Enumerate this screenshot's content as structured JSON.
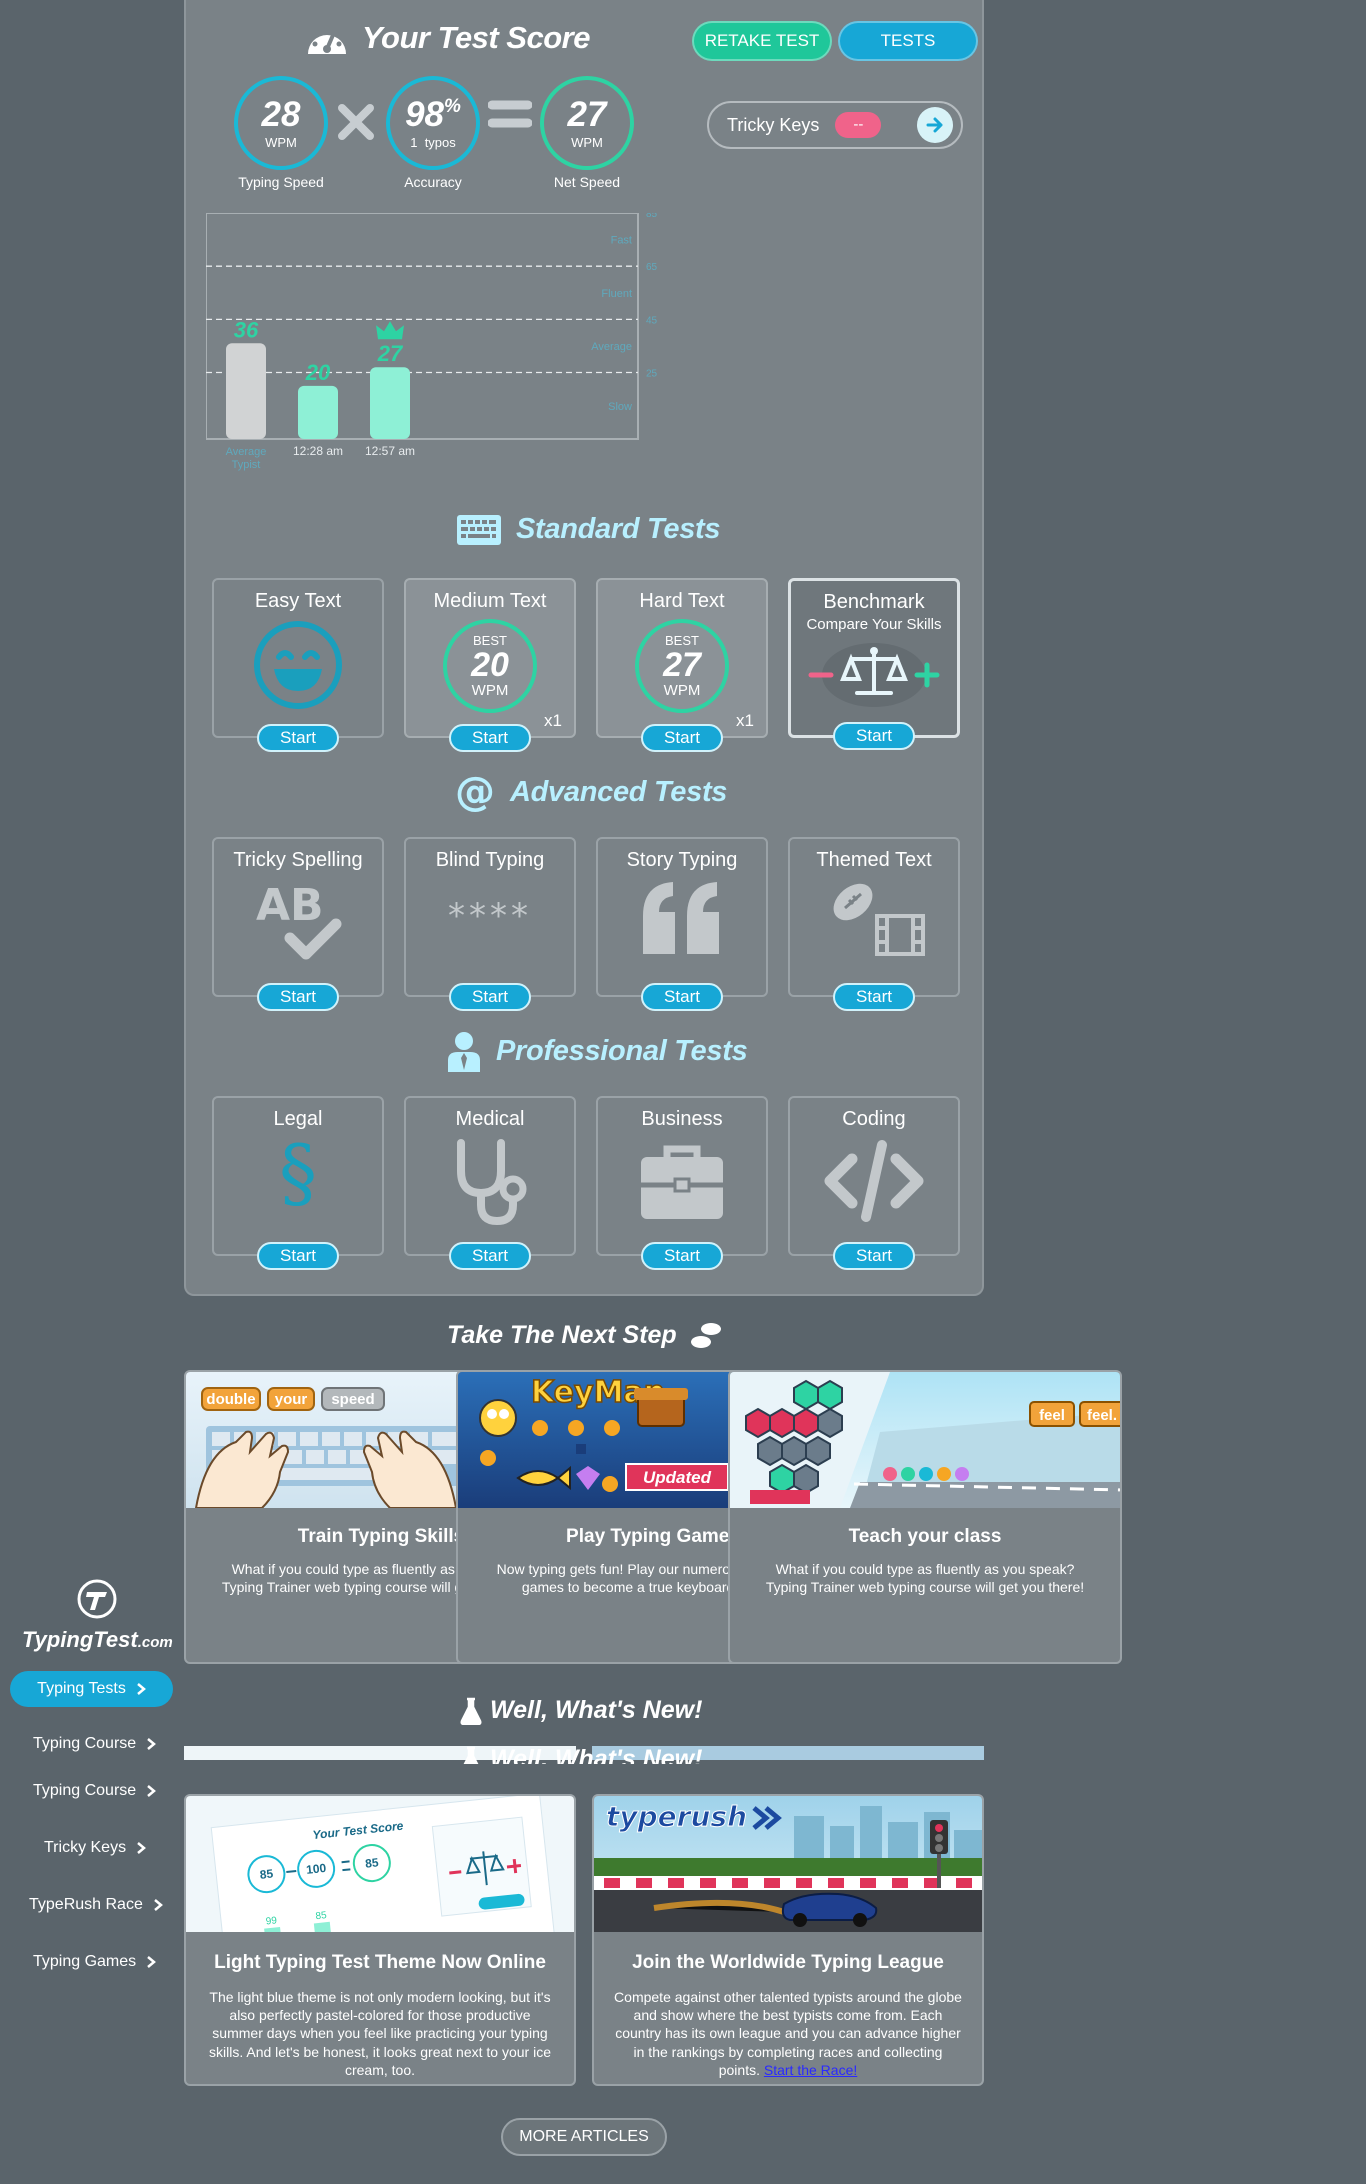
{
  "header": {
    "title": "Your Test Score",
    "retake_label": "RETAKE TEST",
    "tests_label": "TESTS"
  },
  "score": {
    "speed_value": "28",
    "speed_unit": "WPM",
    "speed_label": "Typing Speed",
    "accuracy_value": "98",
    "accuracy_suffix": "%",
    "accuracy_typos": "1  typos",
    "accuracy_label": "Accuracy",
    "net_value": "27",
    "net_unit": "WPM",
    "net_label": "Net Speed"
  },
  "tricky_keys": {
    "label": "Tricky Keys",
    "badge": "--"
  },
  "chart_data": {
    "type": "bar",
    "categories": [
      "Average Typist",
      "12:28 am",
      "12:57 am"
    ],
    "values": [
      36,
      20,
      27
    ],
    "value_labels": [
      "36",
      "20",
      "27"
    ],
    "ylim": [
      0,
      85
    ],
    "y_ticks": [
      25,
      45,
      65,
      85
    ],
    "zones": [
      "Slow",
      "Average",
      "Fluent",
      "Fast"
    ],
    "best_index": 2,
    "colors": {
      "average": "#d1d3d4",
      "user": "#8ef0d6",
      "label": "#2ed3a3",
      "zone_text": "#5fa9bd"
    }
  },
  "standard": {
    "title": "Standard Tests",
    "cards": [
      {
        "title": "Easy Text",
        "start": "Start"
      },
      {
        "title": "Medium Text",
        "best": "BEST",
        "value": "20",
        "unit": "WPM",
        "count": "x1",
        "start": "Start"
      },
      {
        "title": "Hard Text",
        "best": "BEST",
        "value": "27",
        "unit": "WPM",
        "count": "x1",
        "start": "Start"
      },
      {
        "title": "Benchmark",
        "subtitle": "Compare Your Skills",
        "start": "Start"
      }
    ]
  },
  "advanced": {
    "title": "Advanced Tests",
    "cards": [
      {
        "title": "Tricky Spelling",
        "start": "Start"
      },
      {
        "title": "Blind Typing",
        "stars": "****",
        "start": "Start"
      },
      {
        "title": "Story Typing",
        "start": "Start"
      },
      {
        "title": "Themed Text",
        "start": "Start"
      }
    ]
  },
  "professional": {
    "title": "Professional Tests",
    "cards": [
      {
        "title": "Legal",
        "symbol": "§",
        "start": "Start"
      },
      {
        "title": "Medical",
        "start": "Start"
      },
      {
        "title": "Business",
        "start": "Start"
      },
      {
        "title": "Coding",
        "start": "Start"
      }
    ]
  },
  "next_step": {
    "title": "Take The Next Step",
    "cards": [
      {
        "title": "Train Typing Skills",
        "desc": "What if you could type as fluently as you speak? Typing Trainer web typing course will get you there!",
        "tags": [
          "double",
          "your",
          "speed"
        ]
      },
      {
        "title": "Play Typing Games",
        "desc": "Now typing gets fun! Play our numerous fun typing games to become a true keyboard master.",
        "logo": "KeyMan",
        "badge": "Updated"
      },
      {
        "title": "Teach your class",
        "desc": "What if you could type as fluently as you speak? Typing Trainer web typing course will get you there!",
        "tags": [
          "feel",
          "feel."
        ]
      }
    ]
  },
  "whats_new": {
    "title": "Well, What's New!",
    "ghost_title": "Well, What's New!",
    "articles": [
      {
        "title": "Light Typing Test Theme Now Online",
        "desc": "The light blue theme is not only modern looking, but it's also perfectly pastel-colored for those productive summer days when you feel like practicing your typing skills. And let's be honest, it looks great next to your ice cream, too.",
        "thumb_title": "Your Test Score",
        "thumb_values": [
          "85",
          "100",
          "85",
          "99",
          "85"
        ]
      },
      {
        "title": "Join the Worldwide Typing League",
        "desc": "Compete against other talented typists around the globe and show where the best typists come from. Each country has its own league and you can advance higher in the rankings by completing races and collecting points.",
        "link": "Start the Race!",
        "logo": "typerush"
      }
    ],
    "more_label": "MORE ARTICLES"
  },
  "sidebar": {
    "brand": "TypingTest",
    "brand_suffix": ".com",
    "active": "Typing Tests",
    "items": [
      "Typing Course",
      "Typing Course",
      "Tricky Keys",
      "TypeRush Race",
      "Typing Games"
    ]
  }
}
